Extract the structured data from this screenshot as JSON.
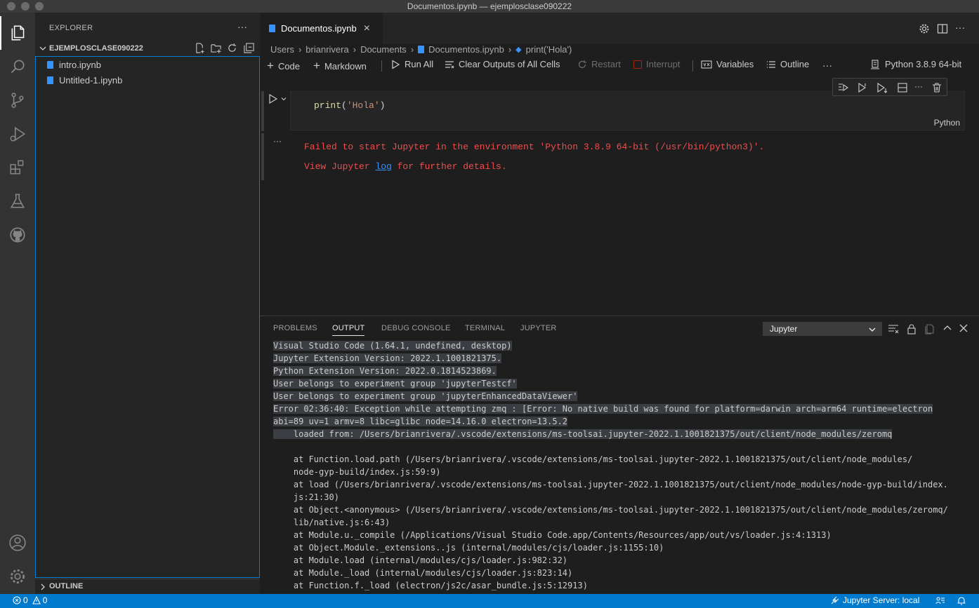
{
  "window": {
    "title": "Documentos.ipynb — ejemplosclase090222"
  },
  "activity_bar": {
    "icons": [
      "files-icon",
      "search-icon",
      "source-control-icon",
      "run-debug-icon",
      "extensions-icon",
      "testing-icon",
      "github-icon",
      "account-icon",
      "gear-icon"
    ]
  },
  "sidebar": {
    "title": "EXPLORER",
    "more": "···",
    "folder": "EJEMPLOSCLASE090222",
    "files": [
      "intro.ipynb",
      "Untitled-1.ipynb"
    ],
    "outline": "OUTLINE"
  },
  "editor": {
    "tab_label": "Documentos.ipynb",
    "tab_close": "×",
    "breadcrumb": [
      "Users",
      "brianrivera",
      "Documents",
      "Documentos.ipynb",
      "print('Hola')"
    ],
    "toolbar": {
      "code": "Code",
      "markdown": "Markdown",
      "run_all": "Run All",
      "clear_outputs": "Clear Outputs of All Cells",
      "restart": "Restart",
      "interrupt": "Interrupt",
      "variables": "Variables",
      "outline": "Outline",
      "more": "···",
      "kernel": "Python 3.8.9 64-bit"
    },
    "cell": {
      "code_fn": "print",
      "code_open": "(",
      "code_str": "'Hola'",
      "code_close": ")",
      "language": "Python",
      "output_more": "···",
      "error_line1": "Failed to start Jupyter in the environment 'Python 3.8.9 64-bit (/usr/bin/python3)'.",
      "error_pre": "View Jupyter ",
      "error_link": "log",
      "error_post": " for further details."
    }
  },
  "panel": {
    "tabs": [
      "PROBLEMS",
      "OUTPUT",
      "DEBUG CONSOLE",
      "TERMINAL",
      "JUPYTER"
    ],
    "active_tab": "OUTPUT",
    "channel": "Jupyter",
    "lines": [
      "Visual Studio Code (1.64.1, undefined, desktop)",
      "Jupyter Extension Version: 2022.1.1001821375.",
      "Python Extension Version: 2022.0.1814523869.",
      "User belongs to experiment group 'jupyterTestcf'",
      "User belongs to experiment group 'jupyterEnhancedDataViewer'",
      "Error 02:36:40: Exception while attempting zmq : [Error: No native build was found for platform=darwin arch=arm64 runtime=electron",
      "abi=89 uv=1 armv=8 libc=glibc node=14.16.0 electron=13.5.2",
      "    loaded from: /Users/brianrivera/.vscode/extensions/ms-toolsai.jupyter-2022.1.1001821375/out/client/node_modules/zeromq",
      "",
      "    at Function.load.path (/Users/brianrivera/.vscode/extensions/ms-toolsai.jupyter-2022.1.1001821375/out/client/node_modules/",
      "    node-gyp-build/index.js:59:9)",
      "    at load (/Users/brianrivera/.vscode/extensions/ms-toolsai.jupyter-2022.1.1001821375/out/client/node_modules/node-gyp-build/index.",
      "    js:21:30)",
      "    at Object.<anonymous> (/Users/brianrivera/.vscode/extensions/ms-toolsai.jupyter-2022.1.1001821375/out/client/node_modules/zeromq/",
      "    lib/native.js:6:43)",
      "    at Module.u._compile (/Applications/Visual Studio Code.app/Contents/Resources/app/out/vs/loader.js:4:1313)",
      "    at Object.Module._extensions..js (internal/modules/cjs/loader.js:1155:10)",
      "    at Module.load (internal/modules/cjs/loader.js:982:32)",
      "    at Module._load (internal/modules/cjs/loader.js:823:14)",
      "    at Function.f._load (electron/js2c/asar_bundle.js:5:12913)"
    ]
  },
  "status_bar": {
    "errors": "0",
    "warnings": "0",
    "jupyter_server": "Jupyter Server: local"
  },
  "colors": {
    "accent": "#007acc",
    "error": "#f14c4c",
    "link": "#3794ff"
  }
}
